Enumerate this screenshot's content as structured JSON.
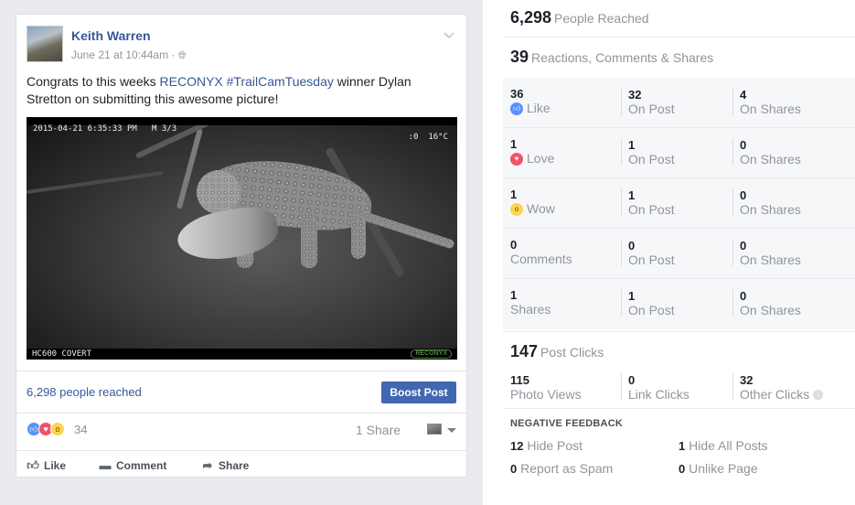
{
  "post": {
    "author": "Keith Warren",
    "date": "June 21 at 10:44am · ",
    "text_pre": "Congrats to this weeks ",
    "text_link": "RECONYX #TrailCamTuesday",
    "text_post": " winner Dylan Stretton on submitting this awesome picture!",
    "photo": {
      "stamp": "2015-04-21 6:35:33 PM   M 3/3",
      "temp": ":0  16°C",
      "model": "HC600 COVERT",
      "logo": "RECONYX"
    },
    "reach_text": "6,298 people reached",
    "boost_label": "Boost Post",
    "reaction_count": "34",
    "share_count": "1 Share",
    "actions": {
      "like": "Like",
      "comment": "Comment",
      "share": "Share"
    }
  },
  "insights": {
    "reached": {
      "num": "6,298",
      "label": "People Reached"
    },
    "rcs": {
      "num": "39",
      "label": "Reactions, Comments & Shares"
    },
    "grid": [
      {
        "c1": {
          "num": "36",
          "label": "Like",
          "emoji": "like"
        },
        "c2": {
          "num": "32",
          "label": "On Post"
        },
        "c3": {
          "num": "4",
          "label": "On Shares"
        }
      },
      {
        "c1": {
          "num": "1",
          "label": "Love",
          "emoji": "love"
        },
        "c2": {
          "num": "1",
          "label": "On Post"
        },
        "c3": {
          "num": "0",
          "label": "On Shares"
        }
      },
      {
        "c1": {
          "num": "1",
          "label": "Wow",
          "emoji": "wow"
        },
        "c2": {
          "num": "1",
          "label": "On Post"
        },
        "c3": {
          "num": "0",
          "label": "On Shares"
        }
      },
      {
        "c1": {
          "num": "0",
          "label": "Comments"
        },
        "c2": {
          "num": "0",
          "label": "On Post"
        },
        "c3": {
          "num": "0",
          "label": "On Shares"
        }
      },
      {
        "c1": {
          "num": "1",
          "label": "Shares"
        },
        "c2": {
          "num": "1",
          "label": "On Post"
        },
        "c3": {
          "num": "0",
          "label": "On Shares"
        }
      }
    ],
    "post_clicks": {
      "num": "147",
      "label": "Post Clicks"
    },
    "clicks": [
      {
        "num": "115",
        "label": "Photo Views"
      },
      {
        "num": "0",
        "label": "Link Clicks"
      },
      {
        "num": "32",
        "label": "Other Clicks"
      }
    ],
    "negative": {
      "title": "NEGATIVE FEEDBACK",
      "hide_post": {
        "num": "12",
        "label": " Hide Post"
      },
      "hide_all": {
        "num": "1",
        "label": " Hide All Posts"
      },
      "spam": {
        "num": "0",
        "label": " Report as Spam"
      },
      "unlike": {
        "num": "0",
        "label": " Unlike Page"
      }
    }
  },
  "colors": {
    "link": "#365899",
    "boost": "#4267b2",
    "muted": "#90949c",
    "like": "#5890ff",
    "love": "#f25268",
    "wow": "#fcd64c"
  }
}
